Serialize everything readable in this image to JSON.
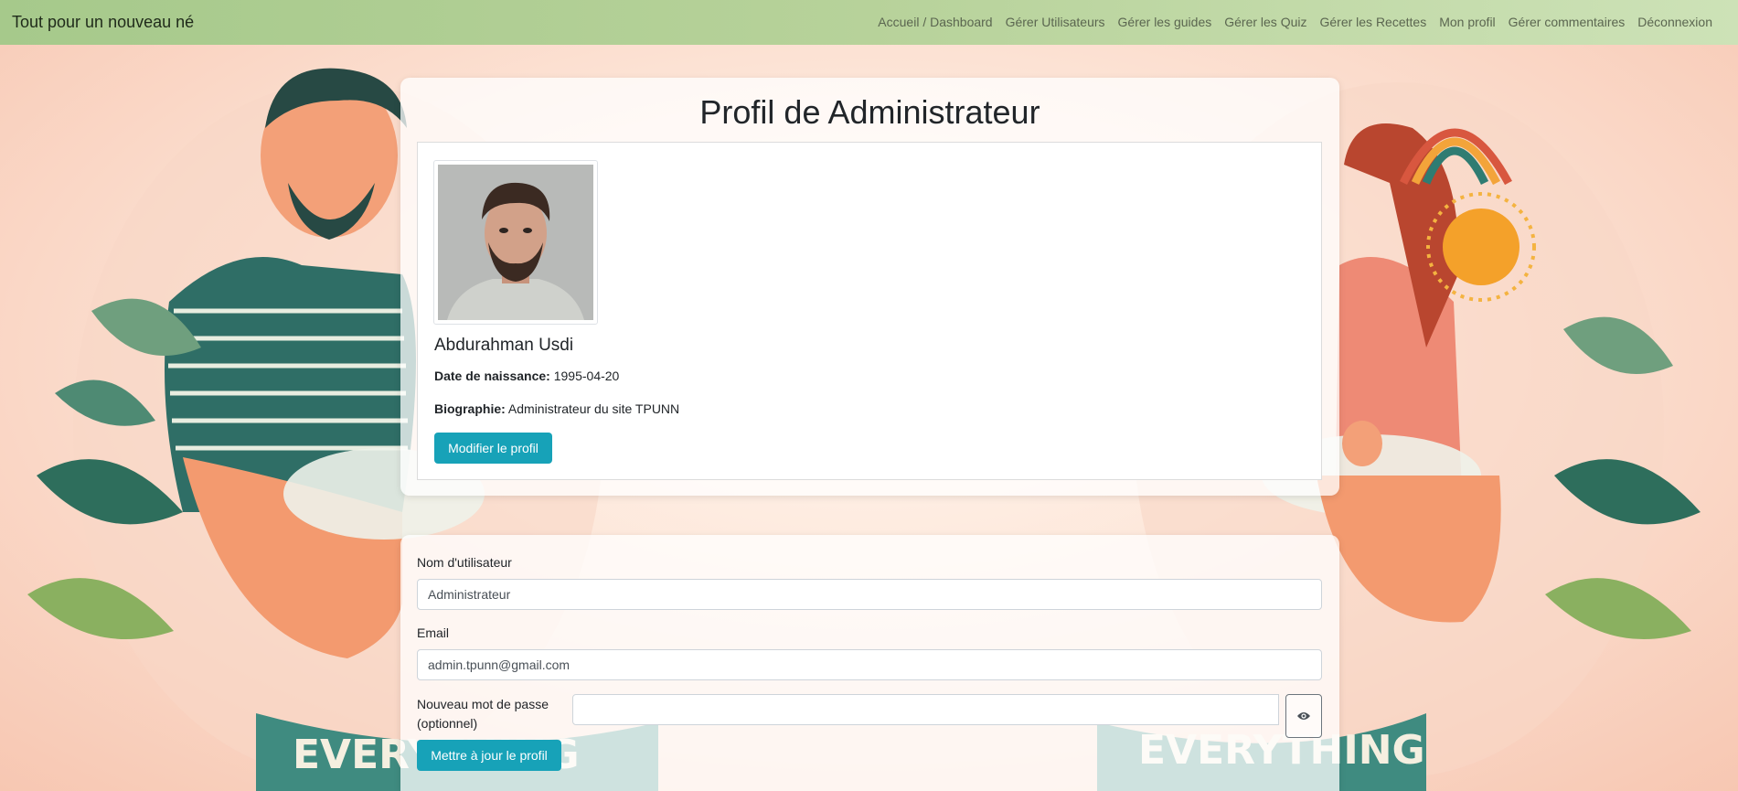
{
  "navbar": {
    "brand": "Tout pour un nouveau né",
    "links": [
      {
        "label": "Accueil / Dashboard"
      },
      {
        "label": "Gérer Utilisateurs"
      },
      {
        "label": "Gérer les guides"
      },
      {
        "label": "Gérer les Quiz"
      },
      {
        "label": "Gérer les Recettes"
      },
      {
        "label": "Mon profil"
      },
      {
        "label": "Gérer commentaires"
      },
      {
        "label": "Déconnexion"
      }
    ]
  },
  "profile": {
    "title": "Profil de Administrateur",
    "name": "Abdurahman Usdi",
    "birth_label": "Date de naissance:",
    "birth_value": "1995-04-20",
    "bio_label": "Biographie:",
    "bio_value": "Administrateur du site TPUNN",
    "edit_button": "Modifier le profil"
  },
  "form": {
    "username_label": "Nom d'utilisateur",
    "username_value": "Administrateur",
    "email_label": "Email",
    "email_value": "admin.tpunn@gmail.com",
    "password_label": "Nouveau mot de passe (optionnel)",
    "password_value": "",
    "submit_button": "Mettre à jour le profil"
  },
  "background": {
    "banner_text_left": "EVERYTHING",
    "banner_text_right": "EVERYTHING"
  },
  "colors": {
    "navbar": "#b7d29a",
    "accent": "#17a2b8"
  }
}
